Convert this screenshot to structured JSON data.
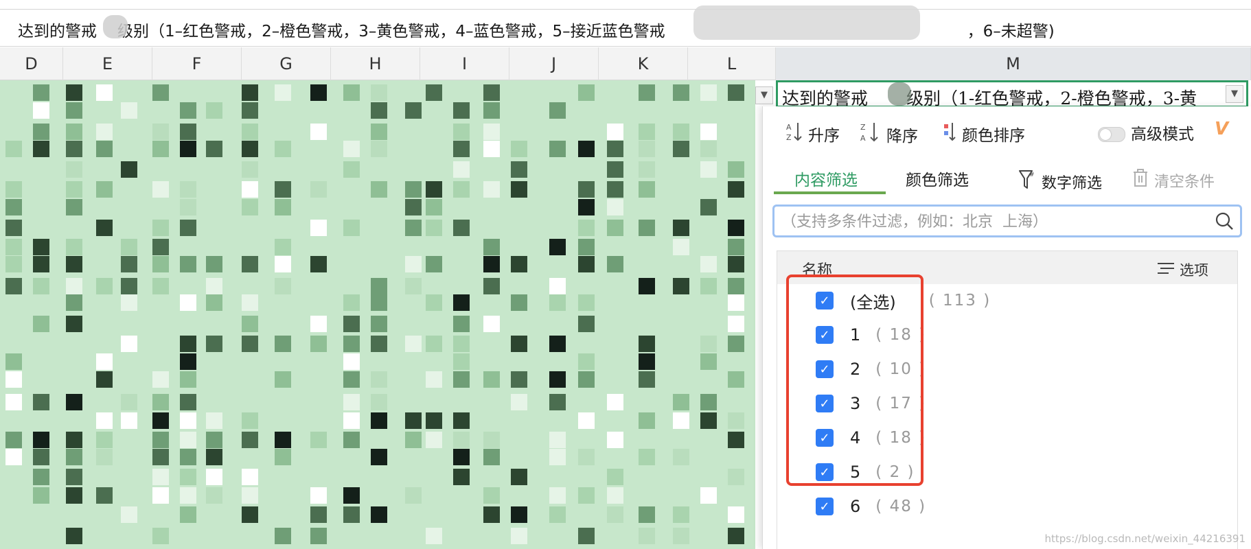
{
  "formula_bar": {
    "text_before": "达到的警戒",
    "text_middle": "级别（1–红色警戒，2–橙色警戒，3–黄色警戒，4–蓝色警戒，5–接近蓝色警戒",
    "text_end": "，6–未超警)"
  },
  "columns": [
    "D",
    "E",
    "F",
    "G",
    "H",
    "I",
    "J",
    "K",
    "L",
    "M"
  ],
  "header_cell": {
    "text_before": "达到的警戒",
    "text_after": "级别（1-红色警戒，2-橙色警戒，3-黄",
    "dropdown_icon": "triangle-down-icon"
  },
  "filter_panel": {
    "sort_asc": "升序",
    "sort_desc": "降序",
    "sort_color": "颜色排序",
    "advanced_mode": "高级模式",
    "vip_badge": "V",
    "tabs": {
      "content": "内容筛选",
      "color": "颜色筛选"
    },
    "number_filter": "数字筛选",
    "clear_conditions": "清空条件",
    "search_placeholder": "（支持多条件过滤，例如：北京  上海）",
    "list_header": "名称",
    "options": "选项",
    "items": [
      {
        "label": "(全选)",
        "count": "( 113 )",
        "checked": true
      },
      {
        "label": "1",
        "count": "( 18 )",
        "checked": true
      },
      {
        "label": "2",
        "count": "( 10 )",
        "checked": true
      },
      {
        "label": "3",
        "count": "( 17 )",
        "checked": true
      },
      {
        "label": "4",
        "count": "( 18 )",
        "checked": true
      },
      {
        "label": "5",
        "count": "( 2 )",
        "checked": true
      },
      {
        "label": "6",
        "count": "( 48 )",
        "checked": true
      }
    ]
  },
  "colors": {
    "accent_green": "#2f9b63",
    "checkbox_blue": "#2f7cf5",
    "highlight_red": "#e8412f",
    "grid_green": "#c7e7cb"
  },
  "watermark": "https://blog.csdn.net/weixin_44216391"
}
